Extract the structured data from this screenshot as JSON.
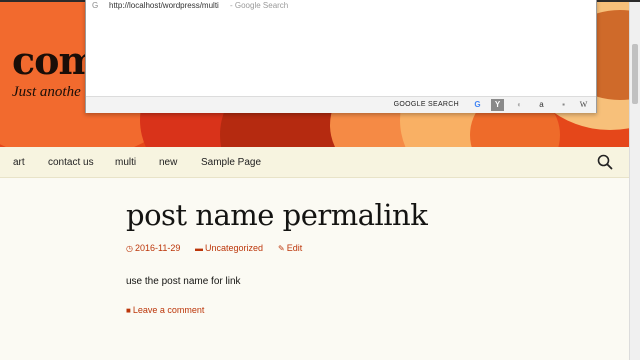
{
  "site": {
    "title": "com",
    "description": "Just anothe"
  },
  "nav": {
    "items": [
      "art",
      "contact us",
      "multi",
      "new",
      "Sample Page"
    ]
  },
  "post": {
    "title": "post name permalink",
    "date": "2016-11-29",
    "category": "Uncategorized",
    "edit": "Edit",
    "body": "use the post name for link",
    "comment": "Leave a comment"
  },
  "omnibox": {
    "g_label": "G",
    "url": "http://localhost/wordpress/multi",
    "hint": "- Google Search",
    "search_label": "GOOGLE SEARCH",
    "engines": [
      "google-icon",
      "yahoo-icon",
      "duckduckgo-icon",
      "amazon-icon",
      "bing-icon",
      "wikipedia-icon"
    ],
    "engine_glyphs": [
      "G",
      "Y",
      "◐",
      "a",
      "▪",
      "W"
    ]
  },
  "colors": {
    "accent": "#bc360a",
    "nav_bg": "#f7f4e0",
    "banner": "#e5471a"
  }
}
